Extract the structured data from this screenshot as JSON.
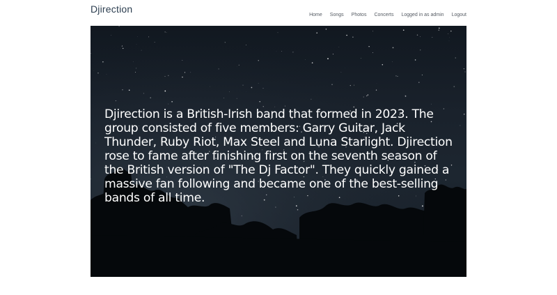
{
  "brand": "Djirection",
  "nav": {
    "items": [
      {
        "label": "Home"
      },
      {
        "label": "Songs"
      },
      {
        "label": "Photos"
      },
      {
        "label": "Concerts"
      },
      {
        "label": "Logged in as admin"
      },
      {
        "label": "Logout"
      }
    ]
  },
  "hero": {
    "text": "Djirection is a British-Irish band that formed in 2023. The group consisted of five members: Garry Guitar, Jack Thunder, Ruby Riot, Max Steel and Luna Starlight. Djirection rose to fame after finishing first on the seventh season of the British version of \"The Dj Factor\". They quickly gained a massive fan following and became one of the best-selling bands of all time."
  },
  "colors": {
    "brand": "#2c3e50",
    "nav_link": "#555b63",
    "hero_text": "#ffffff",
    "hero_sky": "#1a222c"
  }
}
